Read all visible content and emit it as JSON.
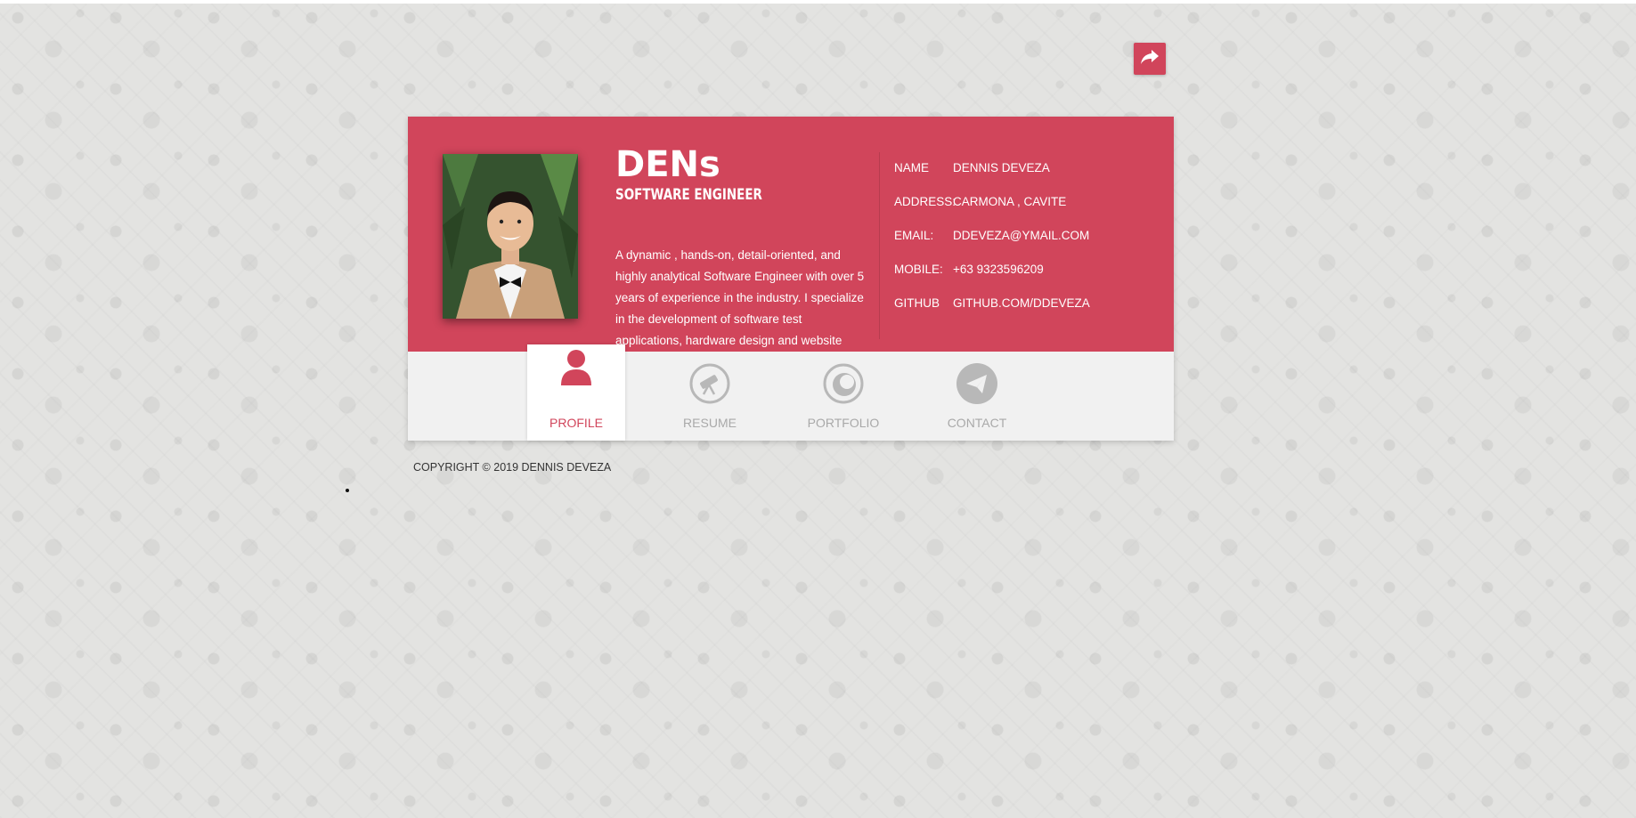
{
  "share": {
    "icon": "share-arrow-icon"
  },
  "profile": {
    "brand": "DENs",
    "role": "SOFTWARE ENGINEER",
    "about": "A dynamic , hands-on, detail-oriented, and highly analytical Software Engineer with over 5 years of experience in the industry. I specialize in the development of software test applications, hardware design and website development.",
    "photo_icon": "profile-photo"
  },
  "info": [
    {
      "label": "NAME",
      "value": "DENNIS DEVEZA"
    },
    {
      "label": "ADDRESS:",
      "value": "CARMONA , CAVITE"
    },
    {
      "label": "EMAIL:",
      "value": "DDEVEZA@YMAIL.COM"
    },
    {
      "label": "MOBILE:",
      "value": "+63 9323596209"
    },
    {
      "label": "GITHUB",
      "value": "GITHUB.COM/DDEVEZA"
    }
  ],
  "tabs": [
    {
      "label": "PROFILE",
      "icon": "user-icon",
      "active": true
    },
    {
      "label": "RESUME",
      "icon": "telescope-icon",
      "active": false
    },
    {
      "label": "PORTFOLIO",
      "icon": "portfolio-icon",
      "active": false
    },
    {
      "label": "CONTACT",
      "icon": "paper-plane-icon",
      "active": false
    }
  ],
  "footer": {
    "copyright": "COPYRIGHT © 2019 DENNIS DEVEZA"
  },
  "colors": {
    "accent": "#d1455b",
    "panel": "#f1f1f1",
    "muted": "#a9a9a9"
  }
}
